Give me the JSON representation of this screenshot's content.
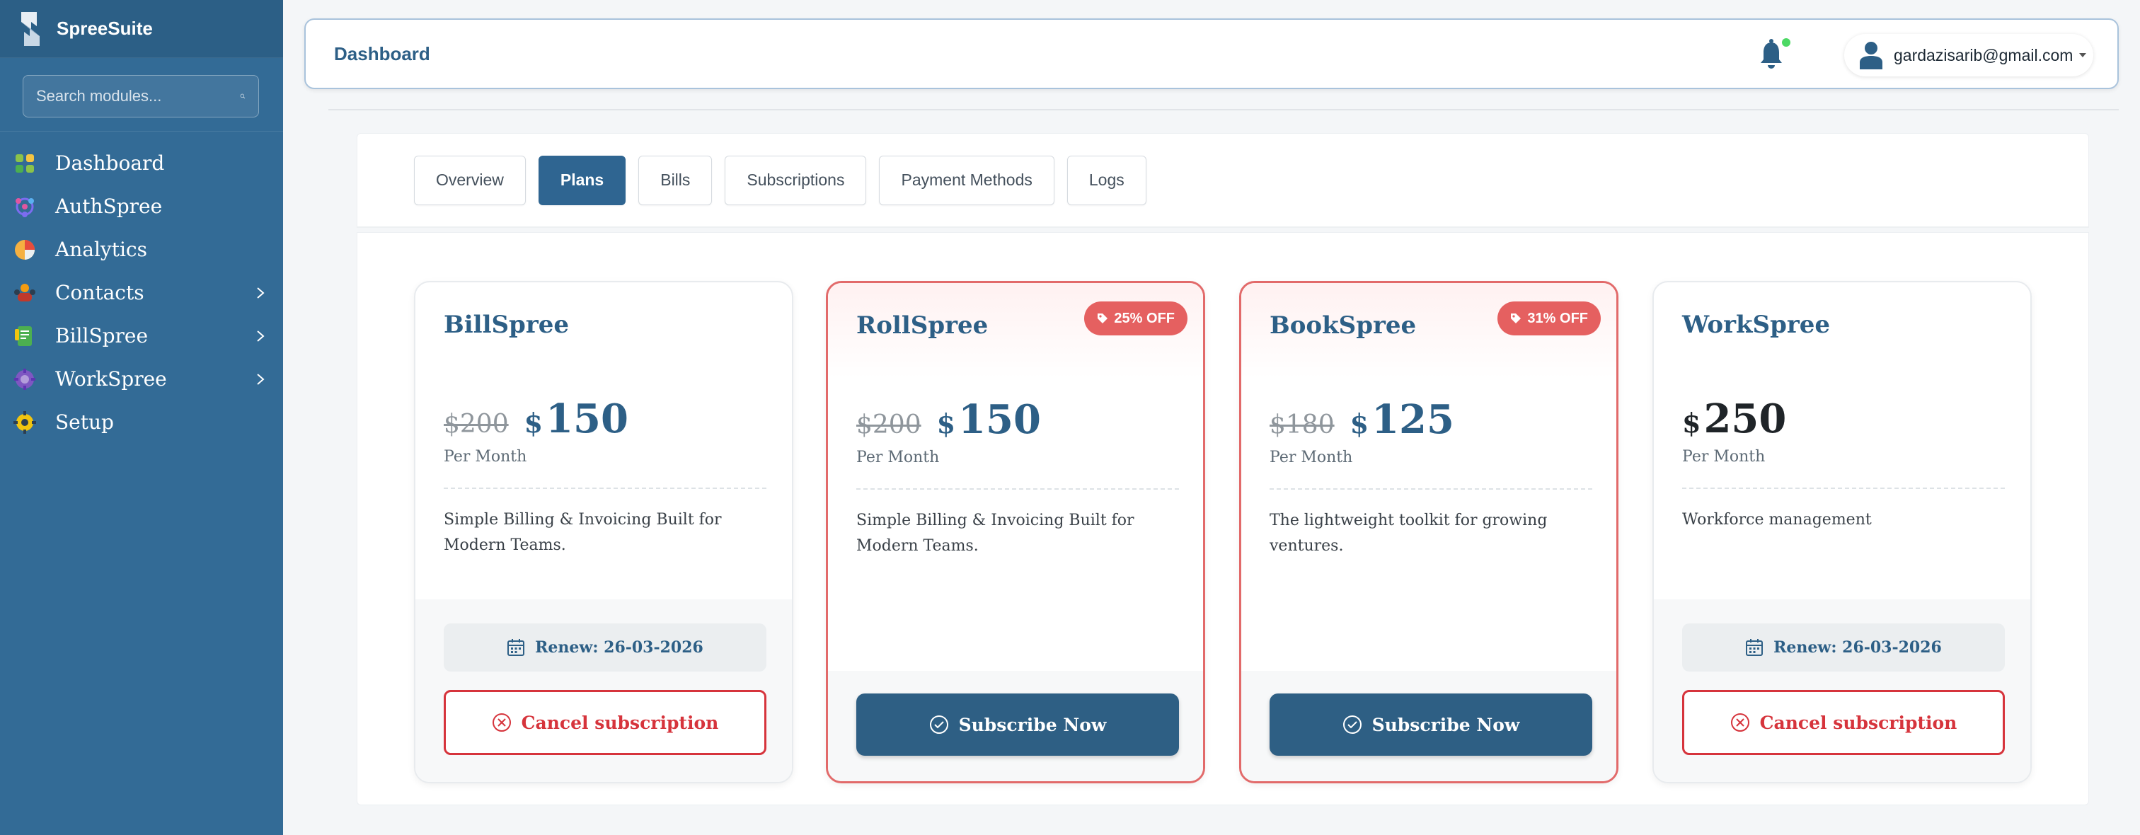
{
  "brand": {
    "name": "SpreeSuite",
    "logo_icon": "spreesuite-logo-icon"
  },
  "search": {
    "placeholder": "Search modules..."
  },
  "sidebar": {
    "items": [
      {
        "label": "Dashboard",
        "icon": "dashboard-icon",
        "has_submenu": false
      },
      {
        "label": "AuthSpree",
        "icon": "authspree-icon",
        "has_submenu": false
      },
      {
        "label": "Analytics",
        "icon": "analytics-icon",
        "has_submenu": false
      },
      {
        "label": "Contacts",
        "icon": "contacts-icon",
        "has_submenu": true
      },
      {
        "label": "BillSpree",
        "icon": "billspree-icon",
        "has_submenu": true
      },
      {
        "label": "WorkSpree",
        "icon": "workspree-icon",
        "has_submenu": true
      },
      {
        "label": "Setup",
        "icon": "setup-icon",
        "has_submenu": false
      }
    ]
  },
  "header": {
    "title": "Dashboard",
    "notification_icon": "bell-icon",
    "notification_dot_color": "#4cd964",
    "user_email": "gardazisarib@gmail.com"
  },
  "tabs": [
    {
      "label": "Overview",
      "active": false
    },
    {
      "label": "Plans",
      "active": true
    },
    {
      "label": "Bills",
      "active": false
    },
    {
      "label": "Subscriptions",
      "active": false
    },
    {
      "label": "Payment Methods",
      "active": false
    },
    {
      "label": "Logs",
      "active": false
    }
  ],
  "plans": [
    {
      "name": "BillSpree",
      "currency": "$",
      "old_price": "$200",
      "price": "150",
      "period": "Per Month",
      "description": "Simple Billing & Invoicing Built for Modern Teams.",
      "badge": "",
      "subscribed": true,
      "renew_label": "Renew: 26-03-2026",
      "action_label": "Cancel subscription"
    },
    {
      "name": "RollSpree",
      "currency": "$",
      "old_price": "$200",
      "price": "150",
      "period": "Per Month",
      "description": "Simple Billing & Invoicing Built for Modern Teams.",
      "badge": "25% OFF",
      "subscribed": false,
      "action_label": "Subscribe Now"
    },
    {
      "name": "BookSpree",
      "currency": "$",
      "old_price": "$180",
      "price": "125",
      "period": "Per Month",
      "description": "The lightweight toolkit for growing ventures.",
      "badge": "31% OFF",
      "subscribed": false,
      "action_label": "Subscribe Now"
    },
    {
      "name": "WorkSpree",
      "currency": "$",
      "old_price": "",
      "price": "250",
      "period": "Per Month",
      "description": "Workforce management",
      "badge": "",
      "subscribed": true,
      "renew_label": "Renew: 26-03-2026",
      "action_label": "Cancel subscription"
    }
  ],
  "colors": {
    "sidebar_bg": "#336b96",
    "primary": "#2d5f86",
    "danger": "#d6343c",
    "badge": "#e56060"
  }
}
